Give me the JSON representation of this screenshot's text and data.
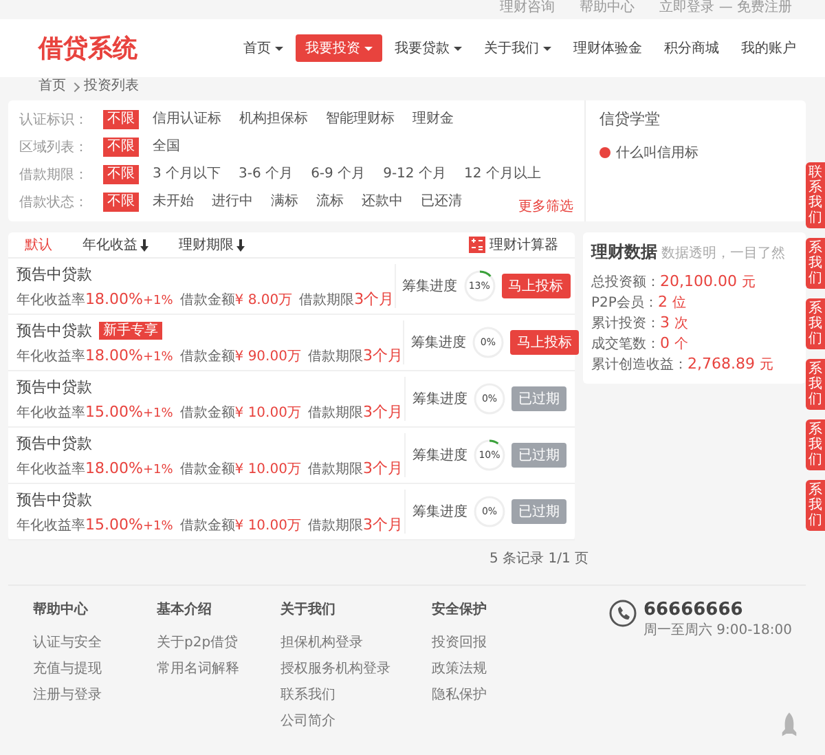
{
  "top_links": [
    "理财咨询",
    "帮助中心",
    "立即登录 — 免费注册"
  ],
  "logo": "借贷系统",
  "nav": [
    {
      "label": "首页",
      "dropdown": true,
      "selected": false
    },
    {
      "label": "我要投资",
      "dropdown": true,
      "selected": true
    },
    {
      "label": "我要贷款",
      "dropdown": true,
      "selected": false
    },
    {
      "label": "关于我们",
      "dropdown": true,
      "selected": false
    },
    {
      "label": "理财体验金",
      "dropdown": false,
      "selected": false
    },
    {
      "label": "积分商城",
      "dropdown": false,
      "selected": false
    },
    {
      "label": "我的账户",
      "dropdown": false,
      "selected": false
    }
  ],
  "breadcrumb": [
    "首页",
    "投资列表"
  ],
  "filters": [
    {
      "label": "认证标识：",
      "options": [
        {
          "text": "不限",
          "selected": true
        },
        {
          "text": "信用认证标",
          "selected": false
        },
        {
          "text": "机构担保标",
          "selected": false
        },
        {
          "text": "智能理财标",
          "selected": false
        },
        {
          "text": "理财金",
          "selected": false
        }
      ]
    },
    {
      "label": "区域列表：",
      "options": [
        {
          "text": "不限",
          "selected": true
        },
        {
          "text": "全国",
          "selected": false
        }
      ]
    },
    {
      "label": "借款期限：",
      "options": [
        {
          "text": "不限",
          "selected": true
        },
        {
          "text": "3 个月以下",
          "selected": false
        },
        {
          "text": "3-6 个月",
          "selected": false
        },
        {
          "text": "6-9 个月",
          "selected": false
        },
        {
          "text": "9-12 个月",
          "selected": false
        },
        {
          "text": "12 个月以上",
          "selected": false
        }
      ]
    },
    {
      "label": "借款状态：",
      "options": [
        {
          "text": "不限",
          "selected": true
        },
        {
          "text": "未开始",
          "selected": false
        },
        {
          "text": "进行中",
          "selected": false
        },
        {
          "text": "满标",
          "selected": false
        },
        {
          "text": "流标",
          "selected": false
        },
        {
          "text": "还款中",
          "selected": false
        },
        {
          "text": "已还清",
          "selected": false
        }
      ]
    }
  ],
  "more_filters": "更多筛选",
  "school": {
    "title": "信贷学堂",
    "items": [
      "什么叫信用标"
    ]
  },
  "sort": [
    {
      "label": "默认",
      "selected": true,
      "arrow": false
    },
    {
      "label": "年化收益",
      "selected": false,
      "arrow": true
    },
    {
      "label": "理财期限",
      "selected": false,
      "arrow": true
    }
  ],
  "calculator": "理财计算器",
  "loans": [
    {
      "title": "预告中贷款",
      "rate_label": "年化收益率",
      "rate": "18.00%",
      "bonus": "+1%",
      "amount_label": "借款金额",
      "amount": "¥ 8.00万",
      "term_label": "借款期限",
      "term": "3个月",
      "progress_label": "筹集进度",
      "level": 0.13,
      "progress": "13%",
      "button": "马上投标",
      "disabled": false
    },
    {
      "title": "预告中贷款",
      "badge": "新手专享",
      "rate_label": "年化收益率",
      "rate": "18.00%",
      "bonus": "+1%",
      "amount_label": "借款金额",
      "amount": "¥ 90.00万",
      "term_label": "借款期限",
      "term": "3个月",
      "progress_label": "筹集进度",
      "level": 0,
      "progress": "0%",
      "button": "马上投标",
      "disabled": false
    },
    {
      "title": "预告中贷款",
      "rate_label": "年化收益率",
      "rate": "15.00%",
      "bonus": "+1%",
      "amount_label": "借款金额",
      "amount": "¥ 10.00万",
      "term_label": "借款期限",
      "term": "3个月",
      "progress_label": "筹集进度",
      "level": 0,
      "progress": "0%",
      "button": "已过期",
      "disabled": true
    },
    {
      "title": "预告中贷款",
      "rate_label": "年化收益率",
      "rate": "18.00%",
      "bonus": "+1%",
      "amount_label": "借款金额",
      "amount": "¥ 10.00万",
      "term_label": "借款期限",
      "term": "3个月",
      "progress_label": "筹集进度",
      "level": 0.1,
      "progress": "10%",
      "button": "已过期",
      "disabled": true
    },
    {
      "title": "预告中贷款",
      "rate_label": "年化收益率",
      "rate": "15.00%",
      "bonus": "+1%",
      "amount_label": "借款金额",
      "amount": "¥ 10.00万",
      "term_label": "借款期限",
      "term": "3个月",
      "progress_label": "筹集进度",
      "level": 0,
      "progress": "0%",
      "button": "已过期",
      "disabled": true
    }
  ],
  "pagination": "5 条记录 1/1 页",
  "stats": {
    "title": "理财数据",
    "subtitle": "数据透明，一目了然",
    "rows": [
      {
        "label": "总投资额：",
        "value": "20,100.00",
        "unit": "元"
      },
      {
        "label": "P2P会员：",
        "value": "2",
        "unit": "位"
      },
      {
        "label": "累计投资：",
        "value": "3",
        "unit": "次"
      },
      {
        "label": "成交笔数：",
        "value": "0",
        "unit": "个"
      },
      {
        "label": "累计创造收益：",
        "value": "2,768.89",
        "unit": "元"
      }
    ]
  },
  "side_tabs": [
    "联系我们",
    "系我们",
    "系我们",
    "系我们",
    "系我们",
    "系我们"
  ],
  "footer": {
    "columns": [
      {
        "title": "帮助中心",
        "links": [
          "认证与安全",
          "充值与提现",
          "注册与登录"
        ]
      },
      {
        "title": "基本介绍",
        "links": [
          "关于p2p借贷",
          "常用名词解释"
        ]
      },
      {
        "title": "关于我们",
        "links": [
          "担保机构登录",
          "授权服务机构登录",
          "联系我们",
          "公司简介"
        ]
      },
      {
        "title": "安全保护",
        "links": [
          "投资回报",
          "政策法规",
          "隐私保护"
        ]
      }
    ],
    "phone": "66666666",
    "hours": "周一至周六 9:00-18:00"
  }
}
